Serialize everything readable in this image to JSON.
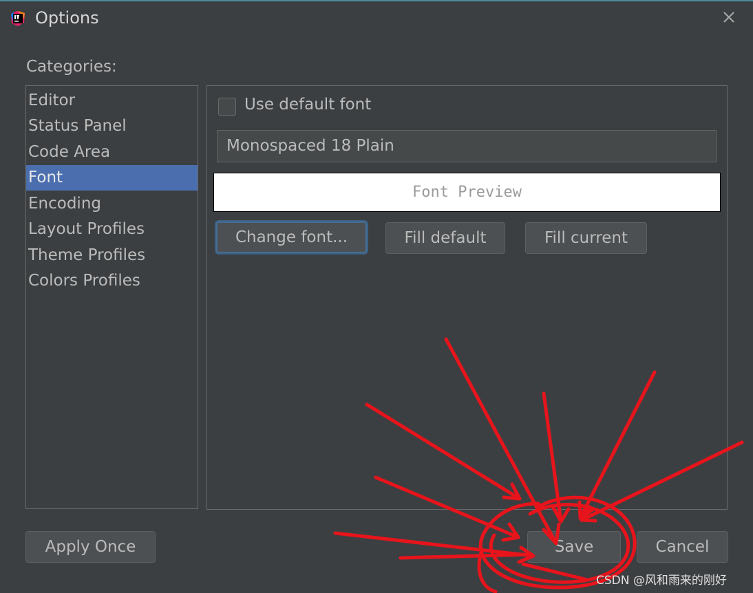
{
  "window": {
    "title": "Options",
    "icon": "intellij-idea-icon"
  },
  "sidebar": {
    "label": "Categories:",
    "items": [
      {
        "label": "Editor"
      },
      {
        "label": "Status Panel"
      },
      {
        "label": "Code Area"
      },
      {
        "label": "Font",
        "selected": true
      },
      {
        "label": "Encoding"
      },
      {
        "label": "Layout Profiles"
      },
      {
        "label": "Theme Profiles"
      },
      {
        "label": "Colors Profiles"
      }
    ]
  },
  "font_panel": {
    "use_default_label": "Use default font",
    "use_default_checked": false,
    "font_value": "Monospaced 18 Plain",
    "preview_text": "Font Preview",
    "change_font_label": "Change font...",
    "fill_default_label": "Fill default",
    "fill_current_label": "Fill current"
  },
  "footer": {
    "apply_once_label": "Apply Once",
    "save_label": "Save",
    "cancel_label": "Cancel"
  },
  "watermark": "CSDN @风和雨来的刚好",
  "colors": {
    "background": "#3c3f41",
    "selection": "#4b6eaf",
    "annotation": "#e8141c"
  }
}
